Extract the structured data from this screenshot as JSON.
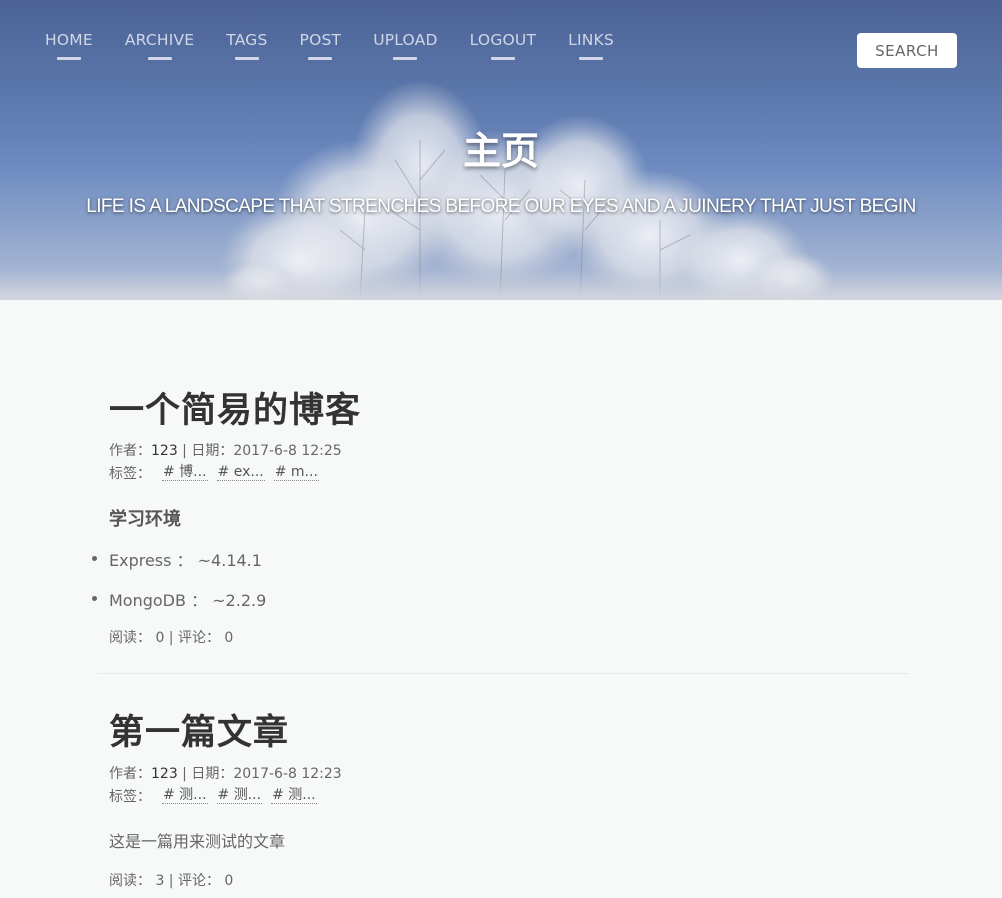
{
  "nav": {
    "items": [
      {
        "label": "HOME"
      },
      {
        "label": "ARCHIVE"
      },
      {
        "label": "TAGS"
      },
      {
        "label": "POST"
      },
      {
        "label": "UPLOAD"
      },
      {
        "label": "LOGOUT"
      },
      {
        "label": "LINKS"
      }
    ],
    "search_label": "SEARCH"
  },
  "hero": {
    "title": "主页",
    "subtitle": "LIFE IS A LANDSCAPE THAT STRENCHES BEFORE OUR EYES AND A JUINERY THAT JUST BEGIN"
  },
  "posts": [
    {
      "title": "一个简易的博客",
      "author_label": "作者：",
      "author": "123",
      "date_sep": " | 日期：",
      "date": "2017-6-8 12:25",
      "tags_label": "标签：",
      "tags": [
        "# 博...",
        "# ex...",
        "# m..."
      ],
      "heading": "学习环境",
      "bullets": [
        "Express ： ~4.14.1",
        "MongoDB ： ~2.2.9"
      ],
      "stats": "阅读： 0 | 评论： 0"
    },
    {
      "title": "第一篇文章",
      "author_label": "作者：",
      "author": "123",
      "date_sep": " | 日期：",
      "date": "2017-6-8 12:23",
      "tags_label": "标签：",
      "tags": [
        "# 测...",
        "# 测...",
        "# 测..."
      ],
      "body": "这是一篇用来测试的文章",
      "stats": "阅读： 3 | 评论： 0"
    }
  ]
}
